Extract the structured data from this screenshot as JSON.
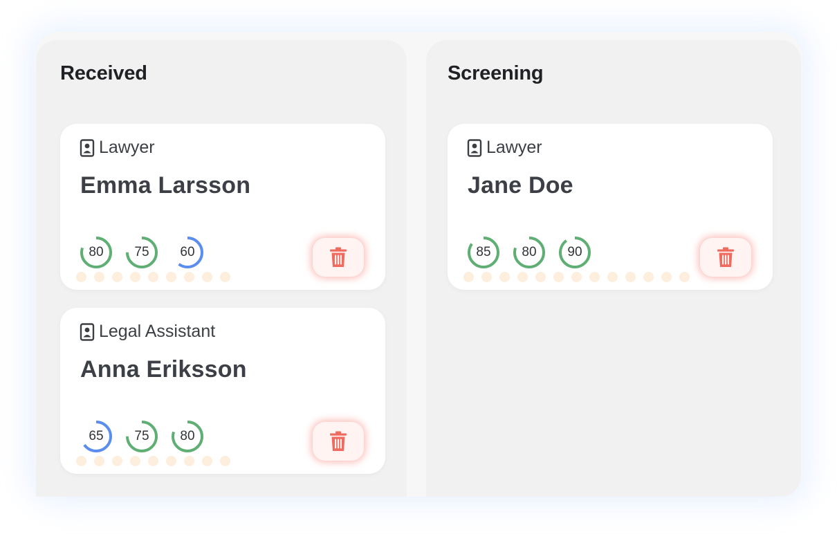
{
  "colors": {
    "score_high": "#5fae74",
    "score_mid": "#5b8def",
    "delete": "#ef6a5f",
    "dot": "#fdeedd"
  },
  "columns": [
    {
      "title": "Received",
      "cards": [
        {
          "role_icon": "id-badge-icon",
          "role": "Lawyer",
          "name": "Emma Larsson",
          "scores": [
            {
              "label": "80",
              "value": 80,
              "color": "green"
            },
            {
              "label": "75",
              "value": 75,
              "color": "green"
            },
            {
              "label": "60",
              "value": 60,
              "color": "blue"
            }
          ],
          "delete_icon": "trash-icon"
        },
        {
          "role_icon": "id-badge-icon",
          "role": "Legal Assistant",
          "name": "Anna Eriksson",
          "scores": [
            {
              "label": "65",
              "value": 65,
              "color": "blue"
            },
            {
              "label": "75",
              "value": 75,
              "color": "green"
            },
            {
              "label": "80",
              "value": 80,
              "color": "green"
            }
          ],
          "delete_icon": "trash-icon"
        }
      ]
    },
    {
      "title": "Screening",
      "cards": [
        {
          "role_icon": "id-badge-icon",
          "role": "Lawyer",
          "name": "Jane Doe",
          "scores": [
            {
              "label": "85",
              "value": 85,
              "color": "green"
            },
            {
              "label": "80",
              "value": 80,
              "color": "green"
            },
            {
              "label": "90",
              "value": 90,
              "color": "green"
            }
          ],
          "delete_icon": "trash-icon"
        }
      ]
    }
  ]
}
